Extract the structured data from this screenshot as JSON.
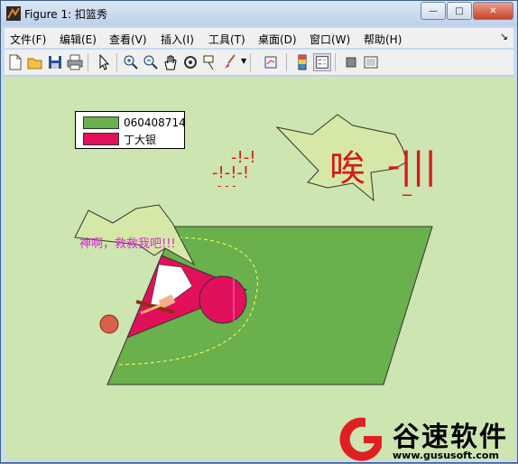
{
  "window": {
    "title": "Figure 1: 扣篮秀",
    "min_label": "—",
    "max_label": "□",
    "close_label": "✕"
  },
  "menubar": {
    "items": [
      "文件(F)",
      "编辑(E)",
      "查看(V)",
      "插入(I)",
      "工具(T)",
      "桌面(D)",
      "窗口(W)",
      "帮助(H)"
    ],
    "overflow_icon": "dock-arrow-icon"
  },
  "toolbar": {
    "icons": [
      "new-figure-icon",
      "open-icon",
      "save-icon",
      "print-icon",
      "pointer-icon",
      "zoom-in-icon",
      "zoom-out-icon",
      "pan-icon",
      "rotate-icon",
      "data-cursor-icon",
      "brush-icon",
      "link-plot-icon",
      "colorbar-icon",
      "legend-icon",
      "hide-plot-tools-icon",
      "show-plot-tools-icon"
    ]
  },
  "plot": {
    "legend": [
      {
        "label": "060408714",
        "color": "#6ab04c"
      },
      {
        "label": "丁大银",
        "color": "#e0105a"
      }
    ],
    "texts": {
      "dots_1": "-!-!",
      "dots_2": "-!-!-!",
      "dots_3": "-  -  -",
      "sigh": "唉",
      "dash_line": "-|||",
      "underscore": "_",
      "cry": "神啊，救救我吧!!!"
    },
    "colors": {
      "court": "#6ab04c",
      "key": "#e0105a",
      "burst": "#d6e8a8",
      "background": "#cde5b0"
    }
  },
  "watermark": {
    "brand": "谷速软件",
    "url": "www.gususoft.com",
    "color": "#e02020"
  }
}
